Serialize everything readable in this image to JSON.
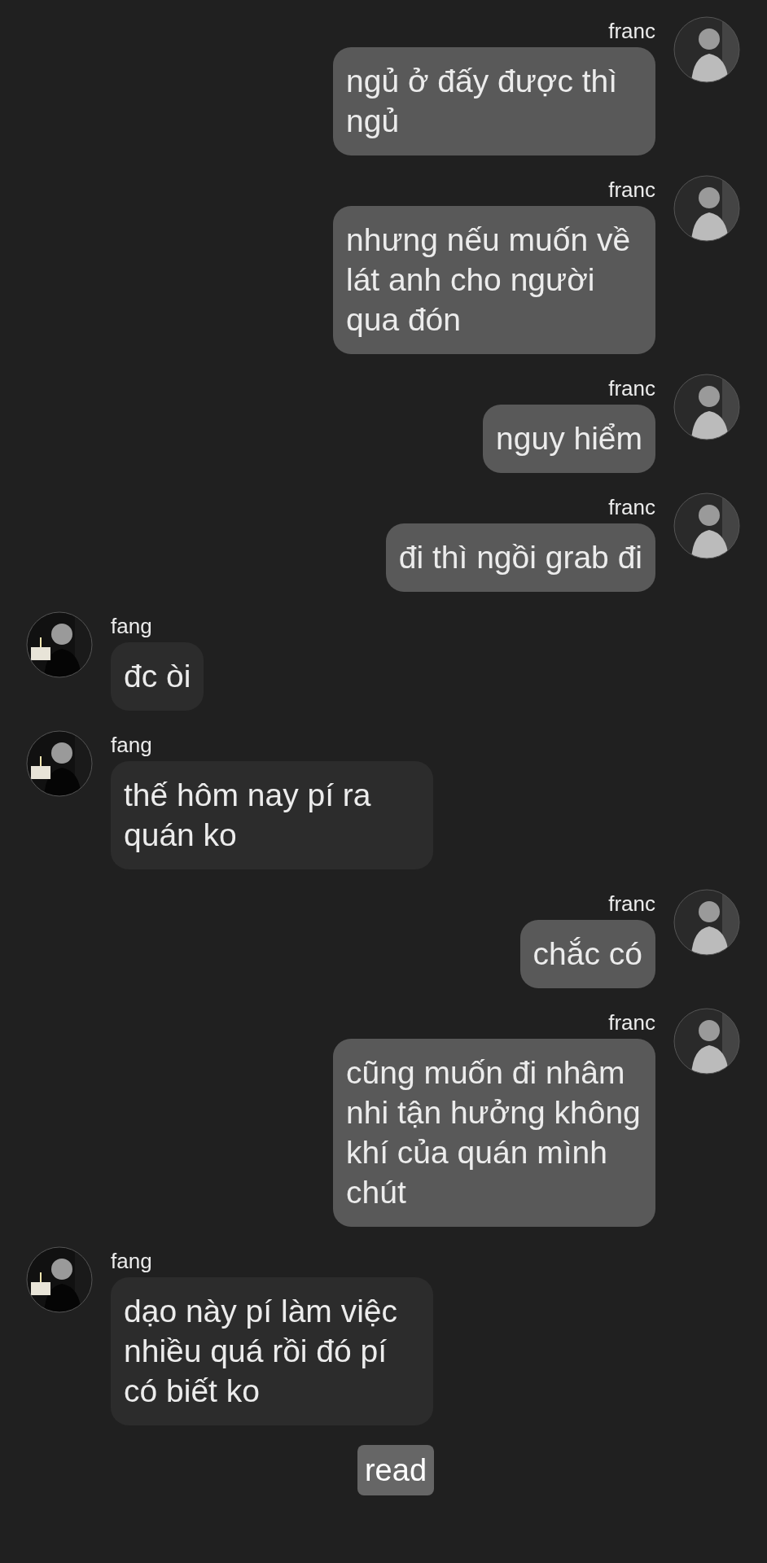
{
  "messages": [
    {
      "kind": "sent",
      "sender": "franc",
      "text": "ngủ ở đấy được thì ngủ"
    },
    {
      "kind": "sent",
      "sender": "franc",
      "text": "nhưng nếu muốn về lát anh cho người qua đón"
    },
    {
      "kind": "sent",
      "sender": "franc",
      "text": "nguy hiểm"
    },
    {
      "kind": "sent",
      "sender": "franc",
      "text": "đi thì ngồi grab đi"
    },
    {
      "kind": "received",
      "sender": "fang",
      "text": "đc òi"
    },
    {
      "kind": "received",
      "sender": "fang",
      "text": "thế hôm nay pí ra quán ko"
    },
    {
      "kind": "sent",
      "sender": "franc",
      "text": "chắc có"
    },
    {
      "kind": "sent",
      "sender": "franc",
      "text": "cũng muốn đi nhâm nhi tận hưởng không khí của quán mình chút"
    },
    {
      "kind": "received",
      "sender": "fang",
      "text": "dạo này pí làm việc nhiều quá rồi đó pí có biết ko"
    }
  ],
  "read_receipt": "read"
}
